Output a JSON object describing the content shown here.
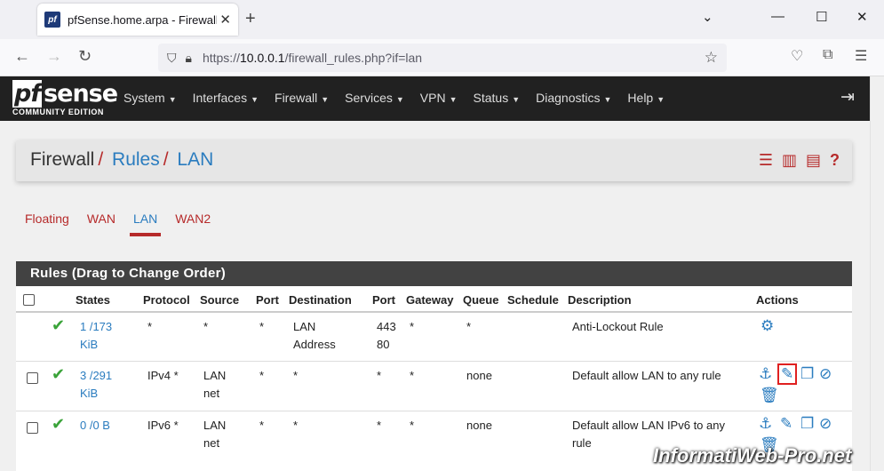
{
  "browser": {
    "tab_title": "pfSense.home.arpa - Firewall: R",
    "url_prefix": "https://",
    "url_host": "10.0.0.1",
    "url_path": "/firewall_rules.php?if=lan"
  },
  "header": {
    "logo_pf": "pf",
    "logo_sense": "sense",
    "logo_sub": "COMMUNITY EDITION",
    "menu": [
      "System",
      "Interfaces",
      "Firewall",
      "Services",
      "VPN",
      "Status",
      "Diagnostics",
      "Help"
    ]
  },
  "breadcrumb": {
    "part1": "Firewall",
    "part2": "Rules",
    "part3": "LAN"
  },
  "subtabs": [
    "Floating",
    "WAN",
    "LAN",
    "WAN2"
  ],
  "rules": {
    "title": "Rules (Drag to Change Order)",
    "columns": [
      "States",
      "Protocol",
      "Source",
      "Port",
      "Destination",
      "Port",
      "Gateway",
      "Queue",
      "Schedule",
      "Description",
      "Actions"
    ],
    "rows": [
      {
        "states1": "1 /173",
        "states2": "KiB",
        "protocol": "*",
        "source1": "*",
        "source2": "",
        "sport": "*",
        "dest1": "LAN",
        "dest2": "Address",
        "dport1": "443",
        "dport2": "80",
        "gateway": "*",
        "queue": "*",
        "schedule": "",
        "desc1": "Anti-Lockout Rule",
        "desc2": ""
      },
      {
        "states1": "3 /291",
        "states2": "KiB",
        "protocol": "IPv4 *",
        "source1": "LAN",
        "source2": "net",
        "sport": "*",
        "dest1": "*",
        "dest2": "",
        "dport1": "*",
        "dport2": "",
        "gateway": "*",
        "queue": "none",
        "schedule": "",
        "desc1": "Default allow LAN to any rule",
        "desc2": ""
      },
      {
        "states1": "0 /0 B",
        "states2": "",
        "protocol": "IPv6 *",
        "source1": "LAN",
        "source2": "net",
        "sport": "*",
        "dest1": "*",
        "dest2": "",
        "dport1": "*",
        "dport2": "",
        "gateway": "*",
        "queue": "none",
        "schedule": "",
        "desc1": "Default allow LAN IPv6 to any",
        "desc2": "rule"
      }
    ]
  },
  "watermark": "InformatiWeb-Pro.net"
}
